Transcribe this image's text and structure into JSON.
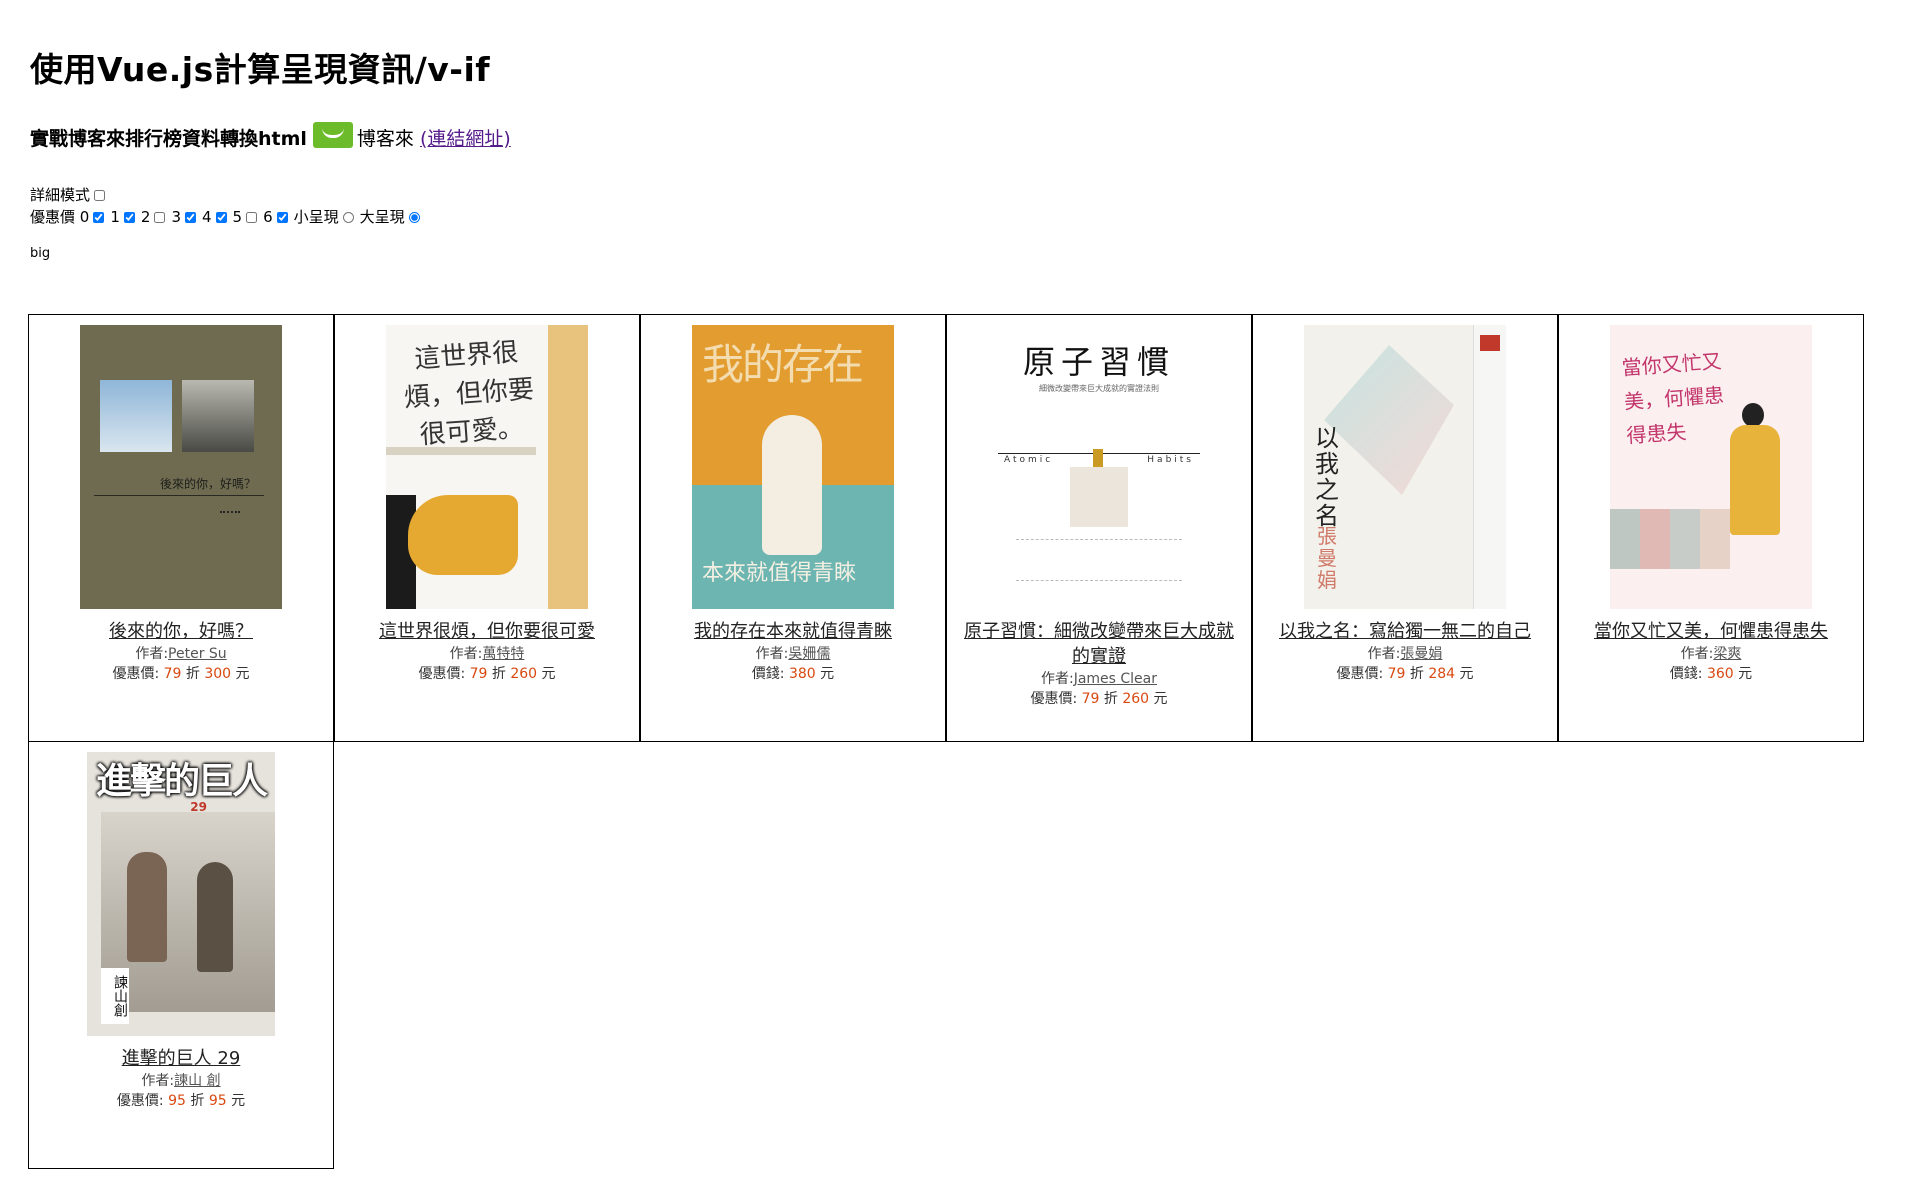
{
  "page": {
    "title": "使用Vue.js計算呈現資訊/v-if",
    "subtitle_prefix": "實戰博客來排行榜資料轉換html",
    "site_name": "博客來",
    "link_label": "(連結網址)",
    "mode_text": "big"
  },
  "controls": {
    "detail_mode_label": "詳細模式",
    "discount_label": "優惠價",
    "discount_options": [
      {
        "label": "0",
        "checked": true
      },
      {
        "label": "1",
        "checked": true
      },
      {
        "label": "2",
        "checked": false
      },
      {
        "label": "3",
        "checked": true
      },
      {
        "label": "4",
        "checked": true
      },
      {
        "label": "5",
        "checked": false
      },
      {
        "label": "6",
        "checked": true
      }
    ],
    "size_options": [
      {
        "label": "小呈現",
        "selected": false
      },
      {
        "label": "大呈現",
        "selected": true
      }
    ]
  },
  "books": [
    {
      "title": "後來的你，好嗎？",
      "author_label": "作者:",
      "author": "Peter Su",
      "price_prefix": "優惠價:",
      "discount": "79",
      "discount_unit": "折",
      "price": "300",
      "currency": "元",
      "cover_title": "後來的你，好嗎？"
    },
    {
      "title": "這世界很煩，但你要很可愛",
      "author_label": "作者:",
      "author": "萬特特",
      "price_prefix": "優惠價:",
      "discount": "79",
      "discount_unit": "折",
      "price": "260",
      "currency": "元",
      "cover_title": "這世界很煩，但你要很可愛。"
    },
    {
      "title": "我的存在本來就值得青睞",
      "author_label": "作者:",
      "author": "吳姍儒",
      "price_prefix": "價錢:",
      "discount": "",
      "discount_unit": "",
      "price": "380",
      "currency": "元",
      "cover_title_top": "我的存在",
      "cover_title_bottom": "本來就值得青睞"
    },
    {
      "title": "原子習慣：細微改變帶來巨大成就的實證",
      "author_label": "作者:",
      "author": "James Clear",
      "price_prefix": "優惠價:",
      "discount": "79",
      "discount_unit": "折",
      "price": "260",
      "currency": "元",
      "cover_title": "原子習慣",
      "cover_sub": "細微改變帶來巨大成就的實證法則",
      "cover_left": "Atomic",
      "cover_right": "Habits"
    },
    {
      "title": "以我之名：寫給獨一無二的自己",
      "author_label": "作者:",
      "author": "張曼娟",
      "price_prefix": "優惠價:",
      "discount": "79",
      "discount_unit": "折",
      "price": "284",
      "currency": "元",
      "cover_title": "以我之名",
      "cover_author": "張曼娟"
    },
    {
      "title": "當你又忙又美，何懼患得患失",
      "author_label": "作者:",
      "author": "梁爽",
      "price_prefix": "價錢:",
      "discount": "",
      "discount_unit": "",
      "price": "360",
      "currency": "元",
      "cover_title": "當你又忙又美，何懼患得患失"
    },
    {
      "title": "進擊的巨人 29",
      "author_label": "作者:",
      "author": "諫山 創",
      "price_prefix": "優惠價:",
      "discount": "95",
      "discount_unit": "折",
      "price": "95",
      "currency": "元",
      "cover_title": "進擊的巨人",
      "cover_num": "29",
      "cover_author": "諫山創"
    }
  ]
}
